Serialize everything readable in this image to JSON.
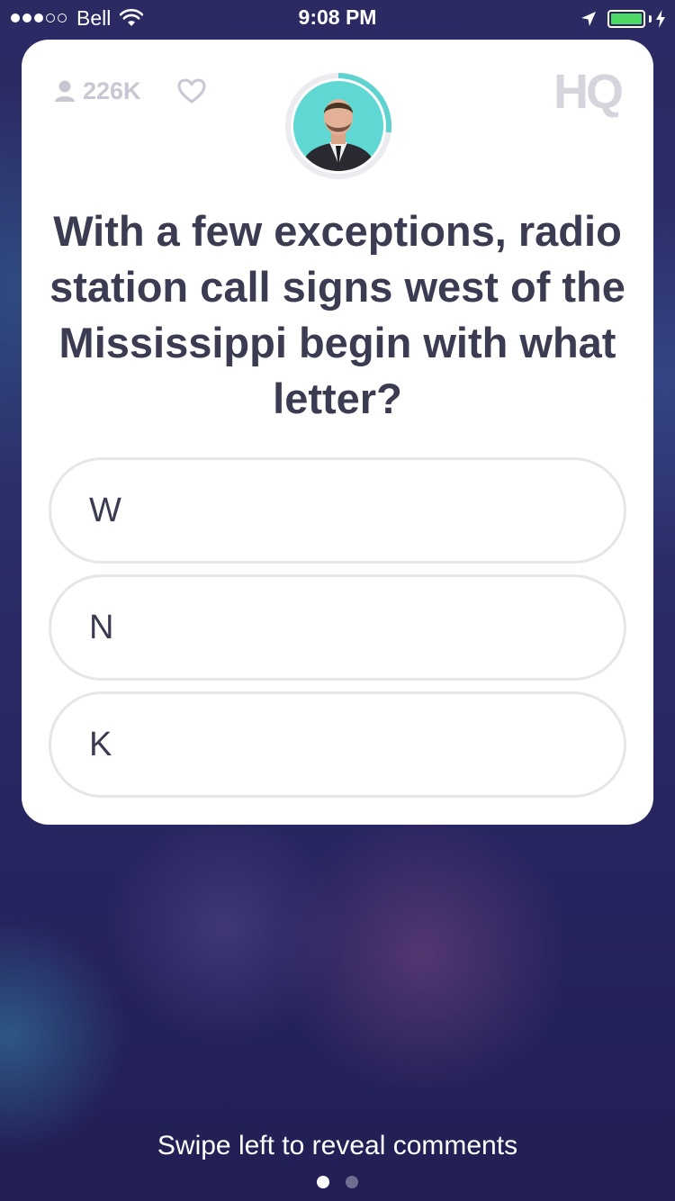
{
  "status_bar": {
    "carrier": "Bell",
    "time": "9:08 PM",
    "signal_bars_filled": 3,
    "signal_bars_total": 5,
    "battery_color": "#4cd964"
  },
  "header": {
    "viewer_count": "226K",
    "logo": "HQ"
  },
  "question": {
    "text": "With a few exceptions, radio station call signs west of the Mississippi begin with what letter?",
    "timer_color": "#5fd3d0"
  },
  "answers": [
    {
      "label": "W"
    },
    {
      "label": "N"
    },
    {
      "label": "K"
    }
  ],
  "footer": {
    "hint": "Swipe left to reveal comments",
    "page_count": 2,
    "current_page": 1
  },
  "icons": [
    "wifi-icon",
    "location-arrow-icon",
    "battery-icon",
    "charging-bolt-icon",
    "person-icon",
    "heart-icon"
  ]
}
